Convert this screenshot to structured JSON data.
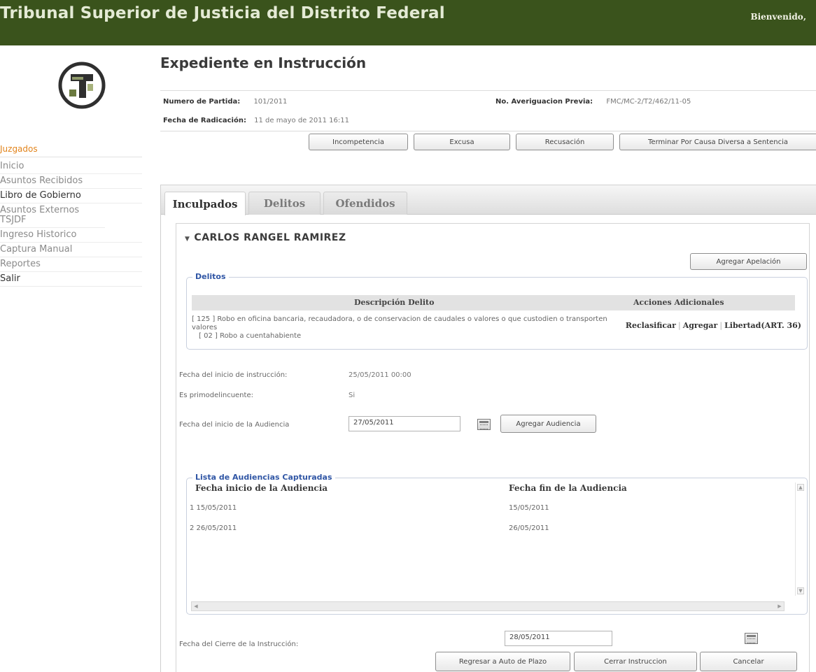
{
  "header": {
    "title": "Tribunal Superior de Justicia del Distrito Federal",
    "welcome": "Bienvenido,"
  },
  "sidebar": {
    "heading": "Juzgados",
    "items": [
      {
        "label": "Inicio"
      },
      {
        "label": "Asuntos Recibidos"
      },
      {
        "label": "Libro de Gobierno"
      },
      {
        "label": "Asuntos Externos TSJDF"
      },
      {
        "label": "Ingreso Historico"
      },
      {
        "label": "Captura Manual"
      },
      {
        "label": "Reportes"
      },
      {
        "label": "Salir"
      }
    ]
  },
  "expediente": {
    "title": "Expediente en Instrucción",
    "numero_partida_label": "Numero de Partida:",
    "numero_partida": "101/2011",
    "averiguacion_label": "No. Averiguacion Previa:",
    "averiguacion": "FMC/MC-2/T2/462/11-05",
    "fecha_radicacion_label": "Fecha de Radicación:",
    "fecha_radicacion": "11 de mayo de 2011 16:11",
    "buttons": {
      "incompetencia": "Incompetencia",
      "excusa": "Excusa",
      "recusacion": "Recusación",
      "terminar": "Terminar Por Causa Diversa a Sentencia"
    }
  },
  "tabs": [
    "Inculpados",
    "Delitos",
    "Ofendidos"
  ],
  "inculpado": {
    "name": "CARLOS RANGEL RAMIREZ",
    "agregar_apelacion": "Agregar Apelación",
    "delitos": {
      "legend": "Delitos",
      "col_descripcion": "Descripción Delito",
      "col_acciones": "Acciones Adicionales",
      "descripcion": "[ 125 ] Robo en oficina bancaria, recaudadora, o de conservacion de caudales o valores o que custodien o transporten valores",
      "sub": "[ 02 ] Robo a cuentahabiente",
      "acciones": [
        "Reclasificar",
        "Agregar",
        "Libertad(ART. 36)"
      ]
    },
    "fecha_inicio_instruccion_label": "Fecha del inicio de instrucción:",
    "fecha_inicio_instruccion": "25/05/2011 00:00",
    "primodelincuente_label": "Es primodelincuente:",
    "primodelincuente": "Si",
    "fecha_inicio_audiencia_label": "Fecha del inicio de la Audiencia",
    "fecha_inicio_audiencia": "27/05/2011",
    "agregar_audiencia": "Agregar Audiencia",
    "audiencias": {
      "legend": "Lista de Audiencias Capturadas",
      "col_inicio": "Fecha inicio de la Audiencia",
      "col_fin": "Fecha fin de la Audiencia",
      "rows": [
        {
          "inicio": "1 15/05/2011",
          "fin": "15/05/2011"
        },
        {
          "inicio": "2 26/05/2011",
          "fin": "26/05/2011"
        }
      ]
    },
    "fecha_cierre_label": "Fecha del Cierre de la Instrucción:",
    "fecha_cierre": "28/05/2011",
    "buttons": {
      "regresar": "Regresar a Auto de Plazo",
      "cerrar": "Cerrar Instruccion",
      "cancelar": "Cancelar"
    }
  },
  "colors": {
    "header_bg": "#3a531c",
    "legend": "#3056a5",
    "sidebar_heading": "#e2841c"
  },
  "icons": [
    "logo-icon",
    "calendar-icon",
    "triangle-down-icon",
    "scroll-arrow-icon"
  ]
}
